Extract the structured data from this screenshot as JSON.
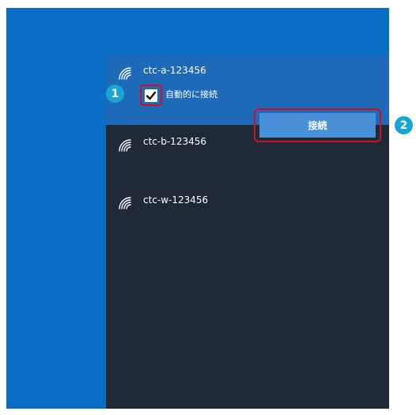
{
  "networks": [
    {
      "ssid": "ctc-a-123456",
      "icon": "wifi-secured-icon",
      "selected": true
    },
    {
      "ssid": "ctc-b-123456",
      "icon": "wifi-secured-icon",
      "selected": false
    },
    {
      "ssid": "ctc-w-123456",
      "icon": "wifi-secured-icon",
      "selected": false
    }
  ],
  "selected_network": {
    "auto_connect_label": "自動的に接続",
    "auto_connect_checked": true,
    "connect_button_label": "接続"
  },
  "callouts": {
    "marker_1": "1",
    "marker_2": "2"
  },
  "colors": {
    "desktop": "#0a6fc4",
    "flyout": "#1f2a36",
    "selected_row": "#1f6ab8",
    "button": "#4a90d9",
    "highlight_outline": "#d0111b",
    "marker": "#17a5d6"
  }
}
